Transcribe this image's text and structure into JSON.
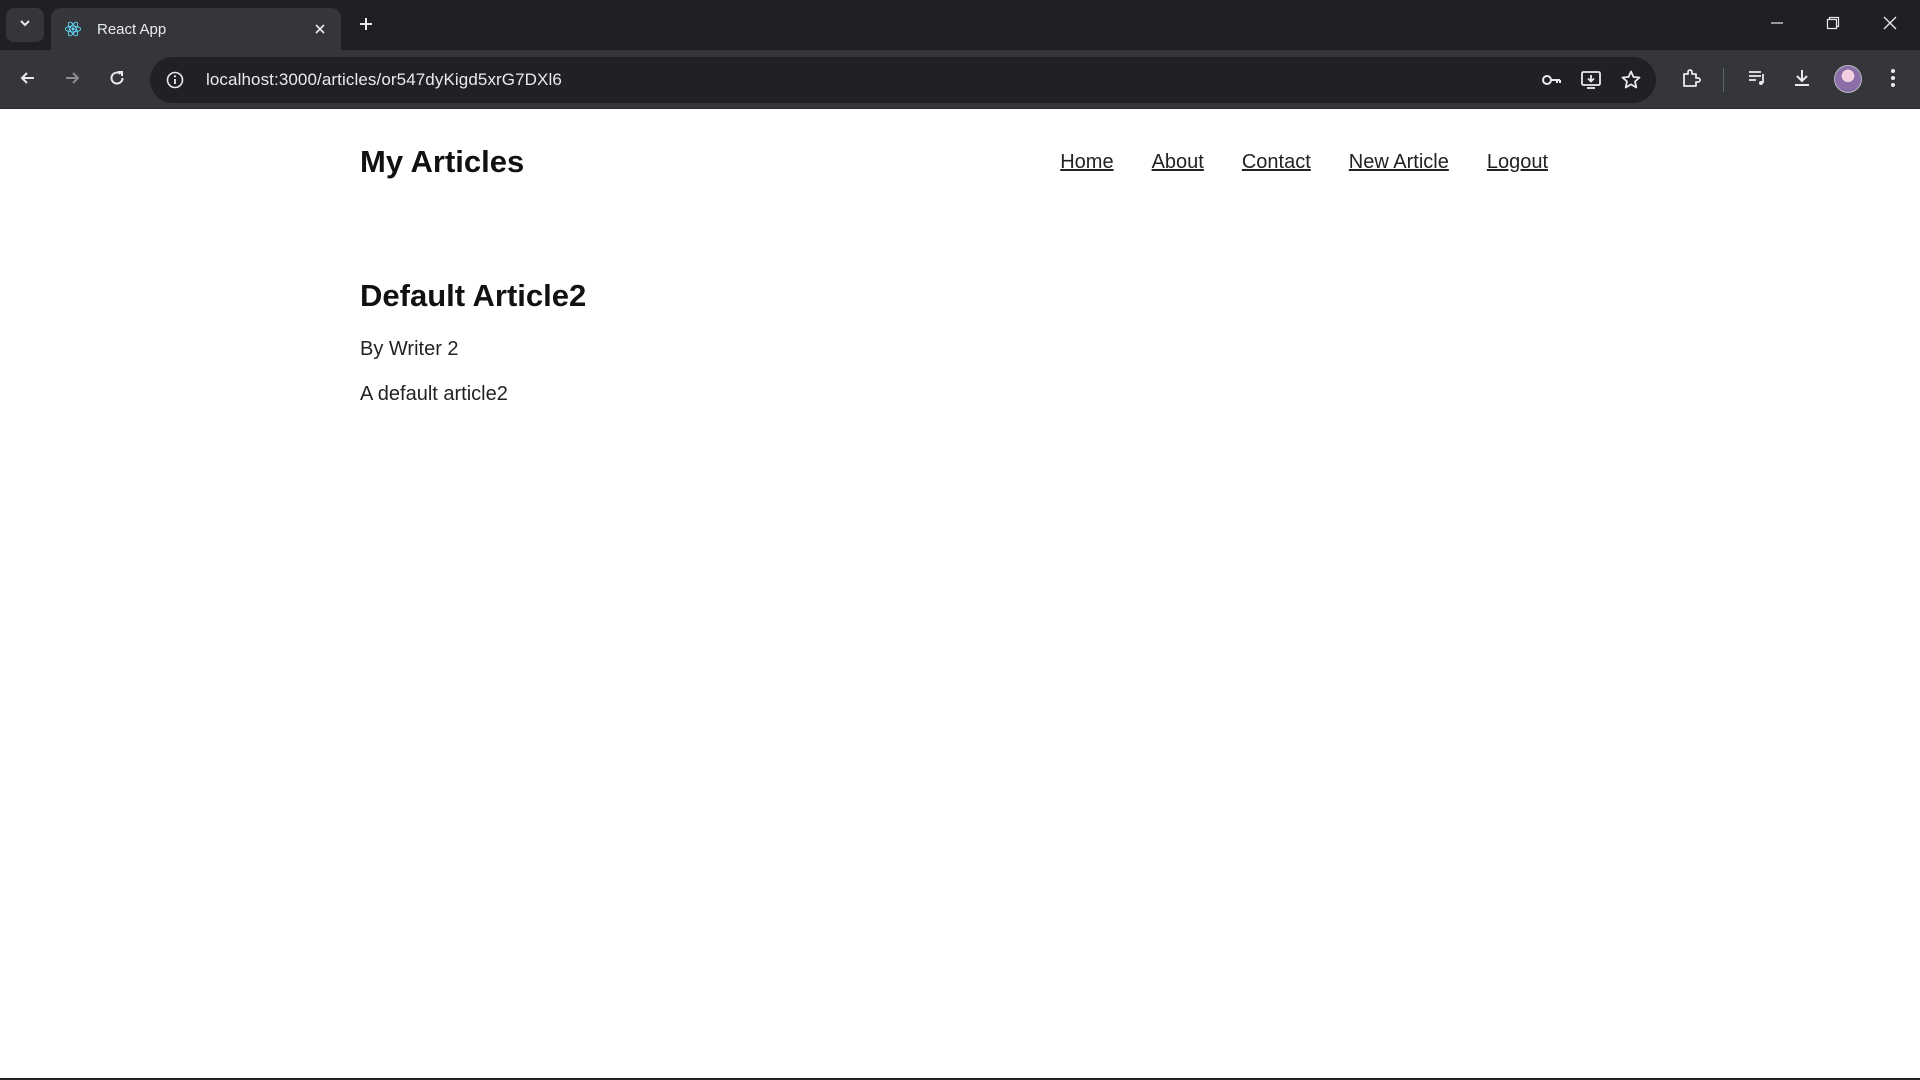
{
  "browser": {
    "tab_title": "React App",
    "url": "localhost:3000/articles/or547dyKigd5xrG7DXl6",
    "accent": "#35363a"
  },
  "site": {
    "title": "My Articles",
    "nav": [
      "Home",
      "About",
      "Contact",
      "New Article",
      "Logout"
    ]
  },
  "article": {
    "title": "Default Article2",
    "byline": "By Writer 2",
    "body": "A default article2"
  }
}
